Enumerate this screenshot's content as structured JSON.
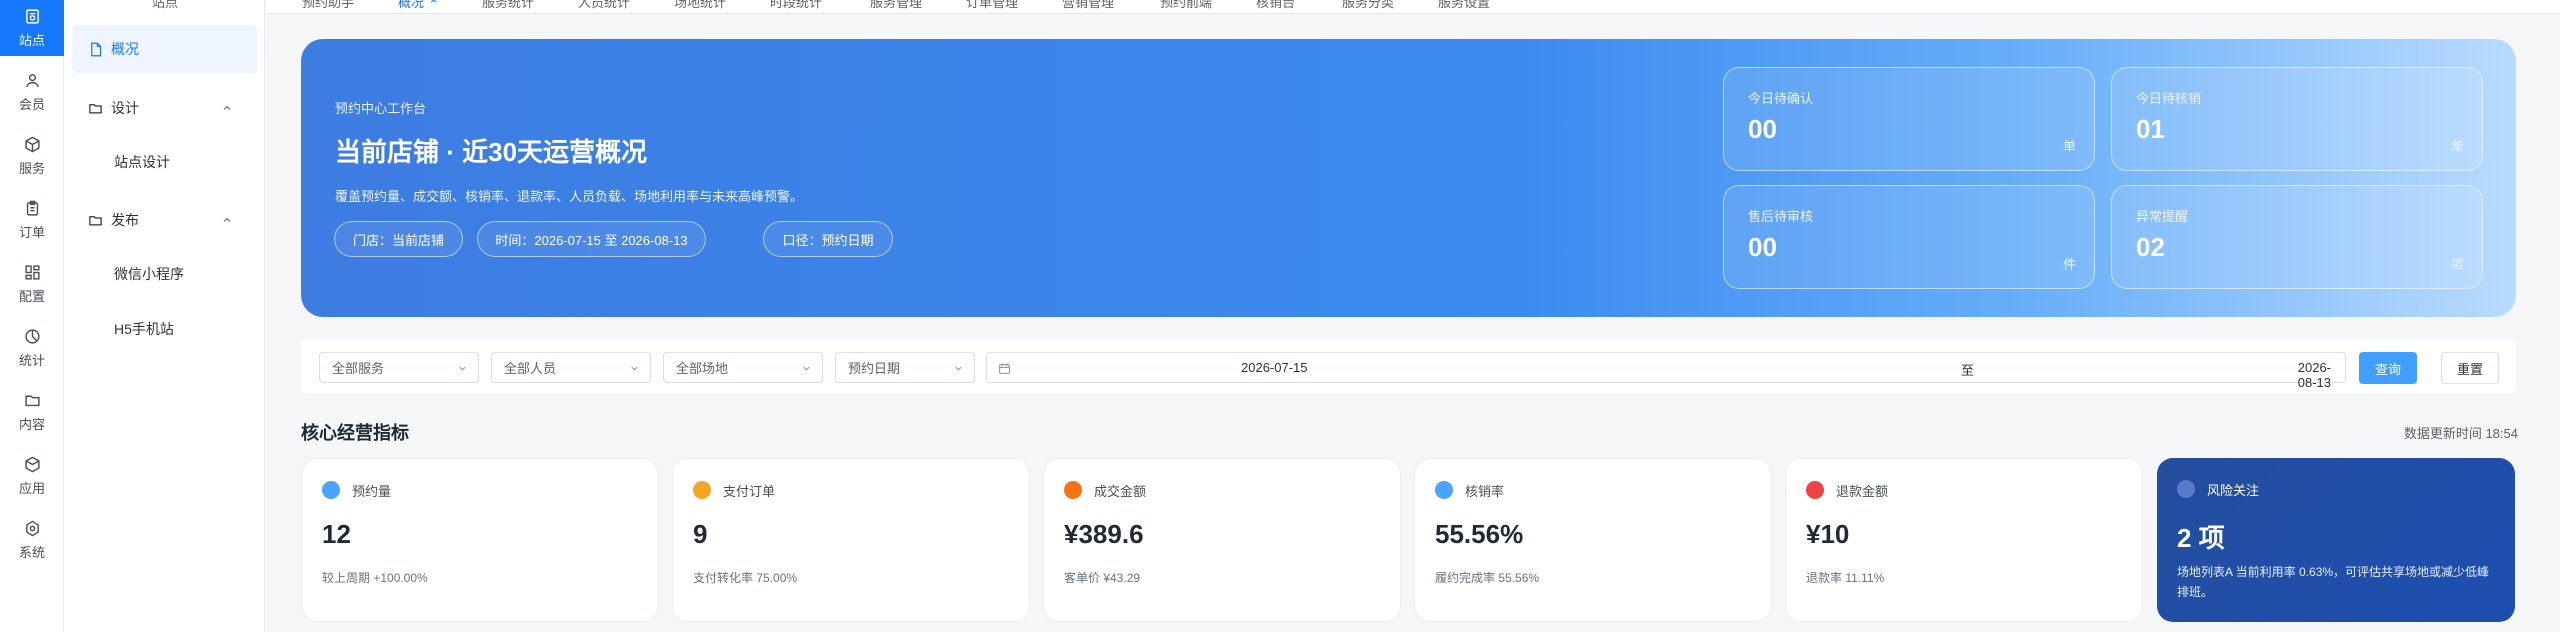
{
  "rail": {
    "items": [
      {
        "label": "站点",
        "icon": "site-icon",
        "active": true
      },
      {
        "label": "会员",
        "icon": "user-icon"
      },
      {
        "label": "服务",
        "icon": "box-icon"
      },
      {
        "label": "订单",
        "icon": "order-icon"
      },
      {
        "label": "配置",
        "icon": "config-icon"
      },
      {
        "label": "统计",
        "icon": "chart-icon"
      },
      {
        "label": "内容",
        "icon": "folder-icon"
      },
      {
        "label": "应用",
        "icon": "app-icon"
      },
      {
        "label": "系统",
        "icon": "gear-icon"
      }
    ]
  },
  "sidebar": {
    "cut_label": "站点",
    "overview": "概况",
    "design": "设计",
    "site_design": "站点设计",
    "publish": "发布",
    "wechat": "微信小程序",
    "h5": "H5手机站"
  },
  "tabs": [
    "预约助手",
    "概况",
    "服务统计",
    "人员统计",
    "场地统计",
    "时段统计",
    "服务管理",
    "订单管理",
    "营销管理",
    "预约前端",
    "核销台",
    "服务分类",
    "服务设置"
  ],
  "hero": {
    "kicker": "预约中心工作台",
    "title": "当前店铺 · 近30天运营概况",
    "desc": "覆盖预约量、成交额、核销率、退款率、人员负载、场地利用率与未来高峰预警。",
    "chips": [
      "门店：当前店铺",
      "时间：2026-07-15 至 2026-08-13",
      "口径：预约日期"
    ],
    "stats": [
      {
        "label": "今日待确认",
        "value": "00",
        "unit": "单"
      },
      {
        "label": "今日待核销",
        "value": "01",
        "unit": "单"
      },
      {
        "label": "售后待审核",
        "value": "00",
        "unit": "件"
      },
      {
        "label": "异常提醒",
        "value": "02",
        "unit": "项"
      }
    ]
  },
  "filter": {
    "service": "全部服务",
    "staff": "全部人员",
    "venue": "全部场地",
    "date_type": "预约日期",
    "start": "2026-07-15",
    "sep": "至",
    "end": "2026-08-13",
    "query": "查询",
    "reset": "重置"
  },
  "section": {
    "title": "核心经营指标",
    "updated": "数据更新时间 18:54"
  },
  "kpis": [
    {
      "label": "预约量",
      "value": "12",
      "note": "较上周期 +100.00%",
      "color": "#4aa3ff"
    },
    {
      "label": "支付订单",
      "value": "9",
      "note": "支付转化率 75.00%",
      "color": "#f5a623"
    },
    {
      "label": "成交金额",
      "value": "¥389.6",
      "note": "客单价 ¥43.29",
      "color": "#f97316"
    },
    {
      "label": "核销率",
      "value": "55.56%",
      "note": "履约完成率 55.56%",
      "color": "#4aa3ff"
    },
    {
      "label": "退款金额",
      "value": "¥10",
      "note": "退款率 11.11%",
      "color": "#ef4444"
    },
    {
      "label": "风险关注",
      "value": "2 项",
      "note": "场地列表A 当前利用率 0.63%，可评估共享场地或减少低峰排班。",
      "color": "#5b78c9"
    }
  ]
}
